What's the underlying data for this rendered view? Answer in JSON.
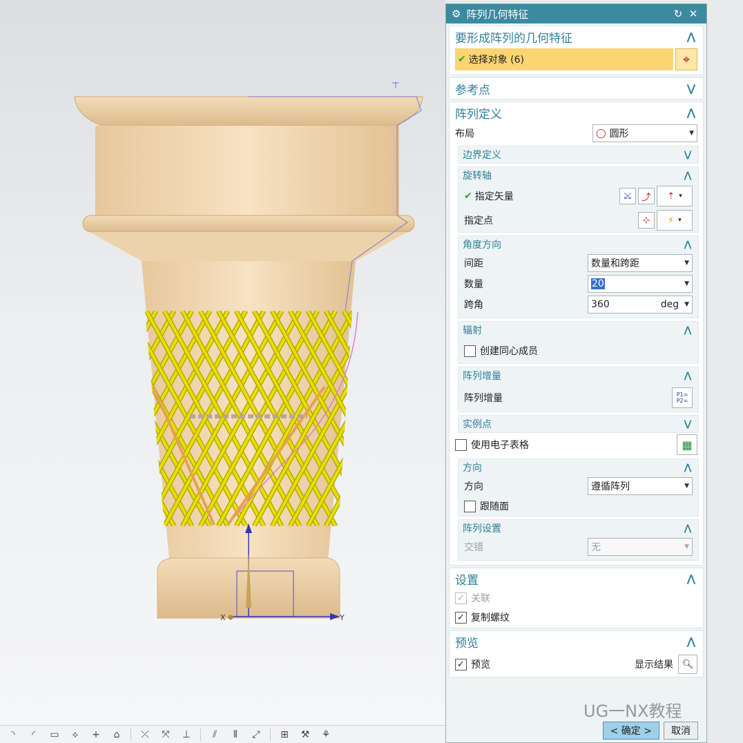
{
  "dialog": {
    "title": "阵列几何特征",
    "groups": {
      "geometry": {
        "title": "要形成阵列的几何特征",
        "select_label": "选择对象 (6)"
      },
      "reference": {
        "title": "参考点"
      },
      "pattern_def": {
        "title": "阵列定义",
        "layout_label": "布局",
        "layout_value": "圆形",
        "boundary": {
          "title": "边界定义"
        },
        "rotation_axis": {
          "title": "旋转轴",
          "specify_vector": "指定矢量",
          "specify_point": "指定点"
        },
        "angle_direction": {
          "title": "角度方向",
          "spacing_label": "间距",
          "spacing_value": "数量和跨距",
          "count_label": "数量",
          "count_value": "20",
          "span_label": "跨角",
          "span_value": "360",
          "span_unit": "deg"
        },
        "radiate": {
          "title": "辐射",
          "concentric_label": "创建同心成员"
        },
        "increment": {
          "title": "阵列增量",
          "label": "阵列增量",
          "icon_text": "P1= P2="
        },
        "instance_points": {
          "title": "实例点"
        },
        "spreadsheet_label": "使用电子表格",
        "orientation": {
          "title": "方向",
          "label": "方向",
          "value": "遵循阵列",
          "follow_face_label": "跟随面"
        },
        "pattern_settings": {
          "title": "阵列设置",
          "stagger_label": "交错",
          "stagger_value": "无"
        }
      },
      "settings": {
        "title": "设置",
        "associative_label": "关联",
        "copy_threads_label": "复制螺纹"
      },
      "preview": {
        "title": "预览",
        "preview_label": "预览",
        "show_result_label": "显示结果"
      }
    },
    "buttons": {
      "ok": "< 确定 >",
      "cancel": "取消"
    }
  },
  "viewport": {
    "axis_x": "X",
    "axis_y": "Y",
    "lattice_color": "#e8e000",
    "body_color": "#f3d9b4"
  },
  "watermark": "UG一NX教程"
}
